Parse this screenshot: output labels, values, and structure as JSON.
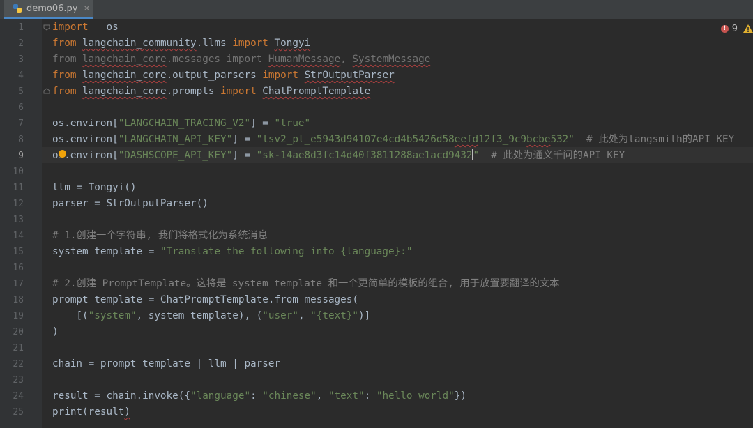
{
  "tab": {
    "label": "demo06.py",
    "close": "✕"
  },
  "inspection": {
    "error_count": "9"
  },
  "code_lines": [
    {
      "n": "1",
      "tokens": [
        [
          "kw",
          "import"
        ],
        [
          "",
          "   os"
        ]
      ]
    },
    {
      "n": "2",
      "tokens": [
        [
          "kw",
          "from "
        ],
        [
          "sq",
          "langchain_community"
        ],
        [
          "",
          ".llms "
        ],
        [
          "kw",
          "import "
        ],
        [
          "sq",
          "Tongyi"
        ]
      ]
    },
    {
      "n": "3",
      "tokens": [
        [
          "dim",
          "from "
        ],
        [
          "dim sq",
          "langchain_core"
        ],
        [
          "dim",
          ".messages import "
        ],
        [
          "dim sq",
          "HumanMessage"
        ],
        [
          "dim",
          ", "
        ],
        [
          "dim sq",
          "SystemMessage"
        ]
      ]
    },
    {
      "n": "4",
      "tokens": [
        [
          "kw",
          "from "
        ],
        [
          "sq",
          "langchain_core"
        ],
        [
          "",
          ".output_parsers "
        ],
        [
          "kw",
          "import "
        ],
        [
          "sq",
          "StrOutputParser"
        ]
      ]
    },
    {
      "n": "5",
      "tokens": [
        [
          "kw",
          "from "
        ],
        [
          "sq",
          "langchain_core"
        ],
        [
          "",
          ".prompts "
        ],
        [
          "kw",
          "import "
        ],
        [
          "sq",
          "ChatPromptTemplate"
        ]
      ]
    },
    {
      "n": "6",
      "tokens": []
    },
    {
      "n": "7",
      "tokens": [
        [
          "",
          "os.environ["
        ],
        [
          "str",
          "\"LANGCHAIN_TRACING_V2\""
        ],
        [
          "",
          "] = "
        ],
        [
          "str",
          "\"true\""
        ]
      ]
    },
    {
      "n": "8",
      "tokens": [
        [
          "",
          "os.environ["
        ],
        [
          "str",
          "\"LANGCHAIN_API_KEY\""
        ],
        [
          "",
          "] = "
        ],
        [
          "str",
          "\"lsv2_pt_e5943d94107e4cd4b5426d58"
        ],
        [
          "str sq",
          "eefd"
        ],
        [
          "str",
          "12f3_9c9"
        ],
        [
          "str sq",
          "bcbe"
        ],
        [
          "str",
          "532\""
        ],
        [
          "cm",
          "  # 此处为langsmith的API KEY"
        ]
      ]
    },
    {
      "n": "9",
      "tokens": [
        [
          "",
          "os.environ["
        ],
        [
          "str",
          "\"DASHSCOPE_API_KEY\""
        ],
        [
          "",
          "] = "
        ],
        [
          "str",
          "\"sk-14ae8d3fc14d40f3811288ae1acd9432"
        ],
        [
          "caret",
          ""
        ],
        [
          "str",
          "\""
        ],
        [
          "cm",
          "  # 此处为通义千问的API KEY"
        ]
      ]
    },
    {
      "n": "10",
      "tokens": []
    },
    {
      "n": "11",
      "tokens": [
        [
          "",
          "llm = Tongyi()"
        ]
      ]
    },
    {
      "n": "12",
      "tokens": [
        [
          "",
          "parser = StrOutputParser()"
        ]
      ]
    },
    {
      "n": "13",
      "tokens": []
    },
    {
      "n": "14",
      "tokens": [
        [
          "cm",
          "# 1.创建一个字符串, 我们将格式化为系统消息"
        ]
      ]
    },
    {
      "n": "15",
      "tokens": [
        [
          "",
          "system_template = "
        ],
        [
          "str",
          "\"Translate the following into {language}:\""
        ]
      ]
    },
    {
      "n": "16",
      "tokens": []
    },
    {
      "n": "17",
      "tokens": [
        [
          "cm",
          "# 2.创建 PromptTemplate。这将是 system_template 和一个更简单的模板的组合, 用于放置要翻译的文本"
        ]
      ]
    },
    {
      "n": "18",
      "tokens": [
        [
          "",
          "prompt_template = ChatPromptTemplate.from_messages("
        ]
      ]
    },
    {
      "n": "19",
      "tokens": [
        [
          "",
          "    [("
        ],
        [
          "str",
          "\"system\""
        ],
        [
          "",
          ", system_template), ("
        ],
        [
          "str",
          "\"user\""
        ],
        [
          "",
          ", "
        ],
        [
          "str",
          "\"{text}\""
        ],
        [
          "",
          ")]"
        ]
      ]
    },
    {
      "n": "20",
      "tokens": [
        [
          "",
          ")"
        ]
      ]
    },
    {
      "n": "21",
      "tokens": []
    },
    {
      "n": "22",
      "tokens": [
        [
          "",
          "chain = prompt_template | llm | parser"
        ]
      ]
    },
    {
      "n": "23",
      "tokens": []
    },
    {
      "n": "24",
      "tokens": [
        [
          "",
          "result = chain.invoke({"
        ],
        [
          "str",
          "\"language\""
        ],
        [
          "",
          ": "
        ],
        [
          "str",
          "\"chinese\""
        ],
        [
          "",
          ", "
        ],
        [
          "str",
          "\"text\""
        ],
        [
          "",
          ": "
        ],
        [
          "str",
          "\"hello world\""
        ],
        [
          "",
          "})"
        ]
      ]
    },
    {
      "n": "25",
      "tokens": [
        [
          "",
          "print(result"
        ],
        [
          "sq",
          ")"
        ]
      ]
    }
  ],
  "colors": {
    "keyword": "#cc7832",
    "string": "#6a8759",
    "comment": "#808080",
    "text": "#a9b7c6"
  }
}
